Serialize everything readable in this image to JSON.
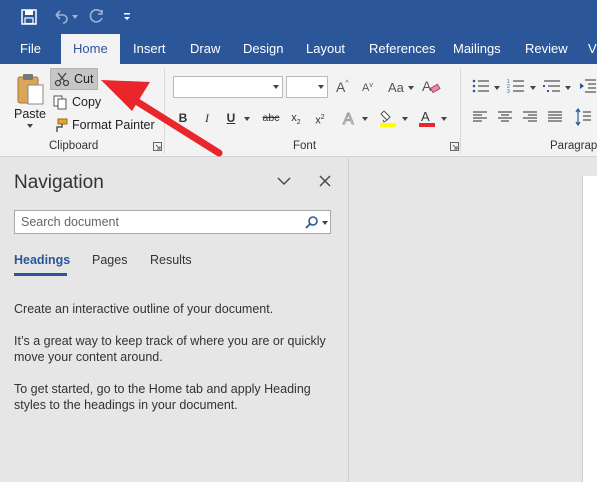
{
  "qat": {
    "save_icon": "save-icon",
    "undo_icon": "undo-icon",
    "redo_icon": "redo-icon",
    "customize_icon": "customize-qat-icon"
  },
  "tabs": [
    {
      "label": "File"
    },
    {
      "label": "Home"
    },
    {
      "label": "Insert"
    },
    {
      "label": "Draw"
    },
    {
      "label": "Design"
    },
    {
      "label": "Layout"
    },
    {
      "label": "References"
    },
    {
      "label": "Mailings"
    },
    {
      "label": "Review"
    },
    {
      "label": "V"
    }
  ],
  "clipboard": {
    "paste": "Paste",
    "cut": "Cut",
    "copy": "Copy",
    "format_painter": "Format Painter",
    "group_label": "Clipboard"
  },
  "font": {
    "font_name": "",
    "font_size": "",
    "group_label": "Font",
    "bold": "B",
    "italic": "I",
    "underline": "U",
    "strike": "abc",
    "grow": "A",
    "shrink": "A",
    "case": "Aa"
  },
  "paragraph": {
    "group_label": "Paragrap"
  },
  "navigation": {
    "title": "Navigation",
    "search_placeholder": "Search document",
    "tabs": [
      {
        "label": "Headings"
      },
      {
        "label": "Pages"
      },
      {
        "label": "Results"
      }
    ],
    "text1": "Create an interactive outline of your document.",
    "text2": "It’s a great way to keep track of where you are or quickly move your content around.",
    "text3": "To get started, go to the Home tab and apply Heading styles to the headings in your document."
  },
  "colors": {
    "accent": "#2b579a",
    "arrow": "#e8262b",
    "highlight": "#ffff00",
    "font_color": "#e8262b"
  }
}
